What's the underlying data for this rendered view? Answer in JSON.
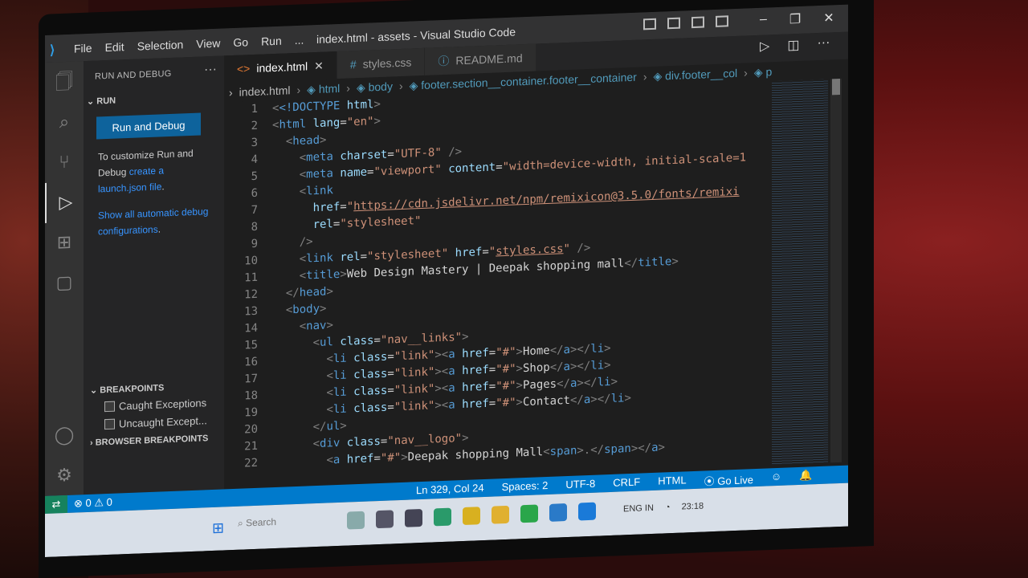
{
  "window": {
    "title": "index.html - assets - Visual Studio Code"
  },
  "menu": [
    "File",
    "Edit",
    "Selection",
    "View",
    "Go",
    "Run",
    "..."
  ],
  "activity_icons": [
    "explorer-icon",
    "search-icon",
    "source-control-icon",
    "run-debug-icon",
    "extensions-icon",
    "remote-explorer-icon"
  ],
  "sidebar": {
    "title": "RUN AND DEBUG",
    "more": "···",
    "section": "RUN",
    "run_button": "Run and Debug",
    "customize_text": "To customize Run and Debug",
    "customize_link": "create a launch.json file",
    "customize_end": ".",
    "show_link": "Show all automatic debug configurations",
    "show_end": ".",
    "breakpoints_header": "BREAKPOINTS",
    "caught": "Caught Exceptions",
    "uncaught": "Uncaught Except...",
    "browser_bp": "BROWSER BREAKPOINTS"
  },
  "tabs": [
    {
      "label": "index.html",
      "active": true
    },
    {
      "label": "styles.css",
      "active": false
    },
    {
      "label": "README.md",
      "active": false
    }
  ],
  "breadcrumb": [
    "index.html",
    "html",
    "body",
    "footer.section__container.footer__container",
    "div.footer__col",
    "p"
  ],
  "code": {
    "lines": [
      "1",
      "2",
      "3",
      "4",
      "5",
      "6",
      "7",
      "8",
      "9",
      "10",
      "11",
      "12",
      "13",
      "14",
      "15",
      "16",
      "17",
      "18",
      "19",
      "20",
      "21",
      "22"
    ],
    "l1_doctype": "<!DOCTYPE",
    "l1_html": "html",
    "l7_href": "https://cdn.jsdelivr.net/npm/remixicon@3.5.0/fonts/remixi",
    "l11_title": "Web Design Mastery | Deepak shopping mall",
    "l16_text": "Home",
    "l17_text": "Shop",
    "l18_text": "Pages",
    "l19_text": "Contact",
    "l22_text": "Deepak shopping Mall"
  },
  "status": {
    "errors": "⊗ 0 ⚠ 0",
    "position": "Ln 329, Col 24",
    "spaces": "Spaces: 2",
    "encoding": "UTF-8",
    "eol": "CRLF",
    "language": "HTML",
    "golive": "Go Live"
  },
  "taskbar": {
    "search": "Search",
    "lang": "ENG IN",
    "time": "23:18"
  }
}
